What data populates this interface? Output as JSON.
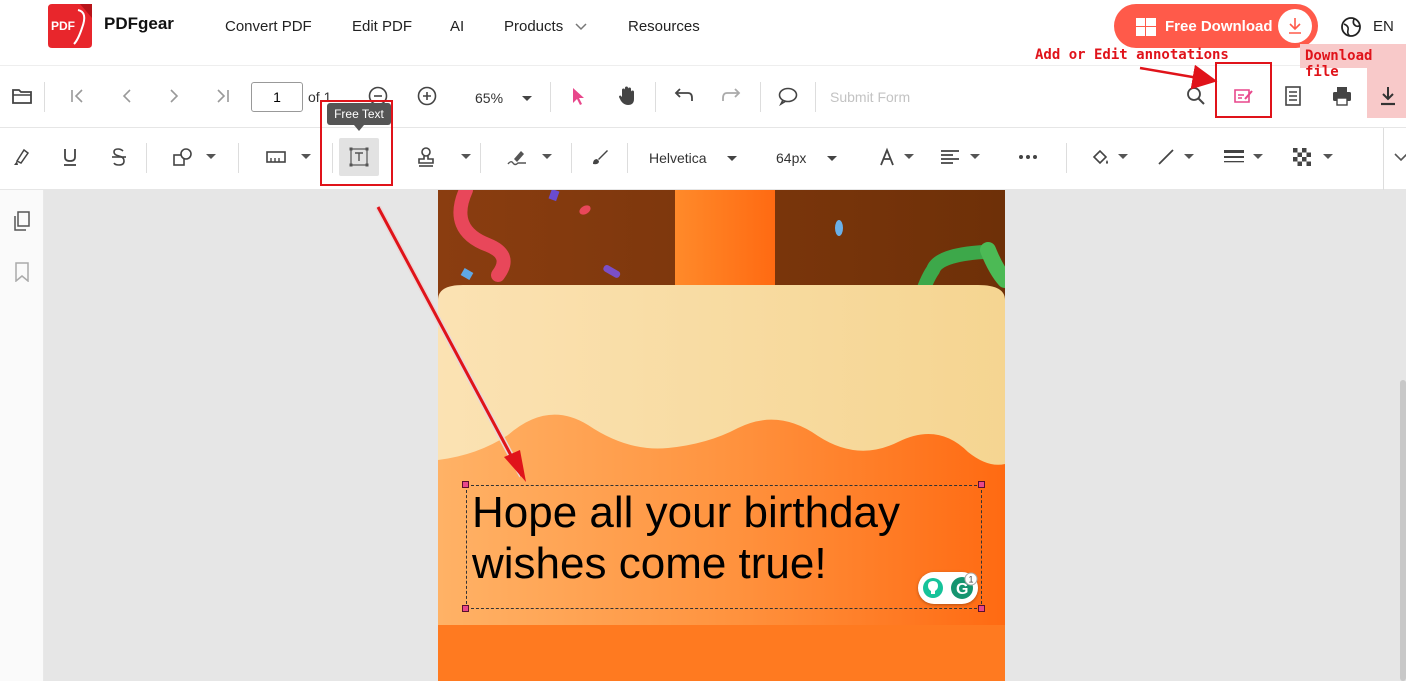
{
  "nav": {
    "brand": "PDFgear",
    "logo_text": "PDF",
    "links": [
      "Convert PDF",
      "Edit PDF",
      "AI",
      "Products",
      "Resources"
    ],
    "free_download": "Free Download",
    "language": "EN"
  },
  "toolbar": {
    "page_value": "1",
    "page_of": "of 1",
    "zoom": "65%",
    "submit_form": "Submit Form"
  },
  "annotation_toolbar": {
    "font": "Helvetica",
    "font_size": "64px",
    "tooltip": "Free Text"
  },
  "callouts": {
    "annotations": "Add or Edit annotations",
    "download": "Download file"
  },
  "document": {
    "line1": "Hope all your birthday",
    "line2": "wishes come true!"
  },
  "grammarly": {
    "count": "1"
  },
  "colors": {
    "accent": "#ff5a4a",
    "callout_red": "#e0131a",
    "select_pink": "#e8478b"
  }
}
